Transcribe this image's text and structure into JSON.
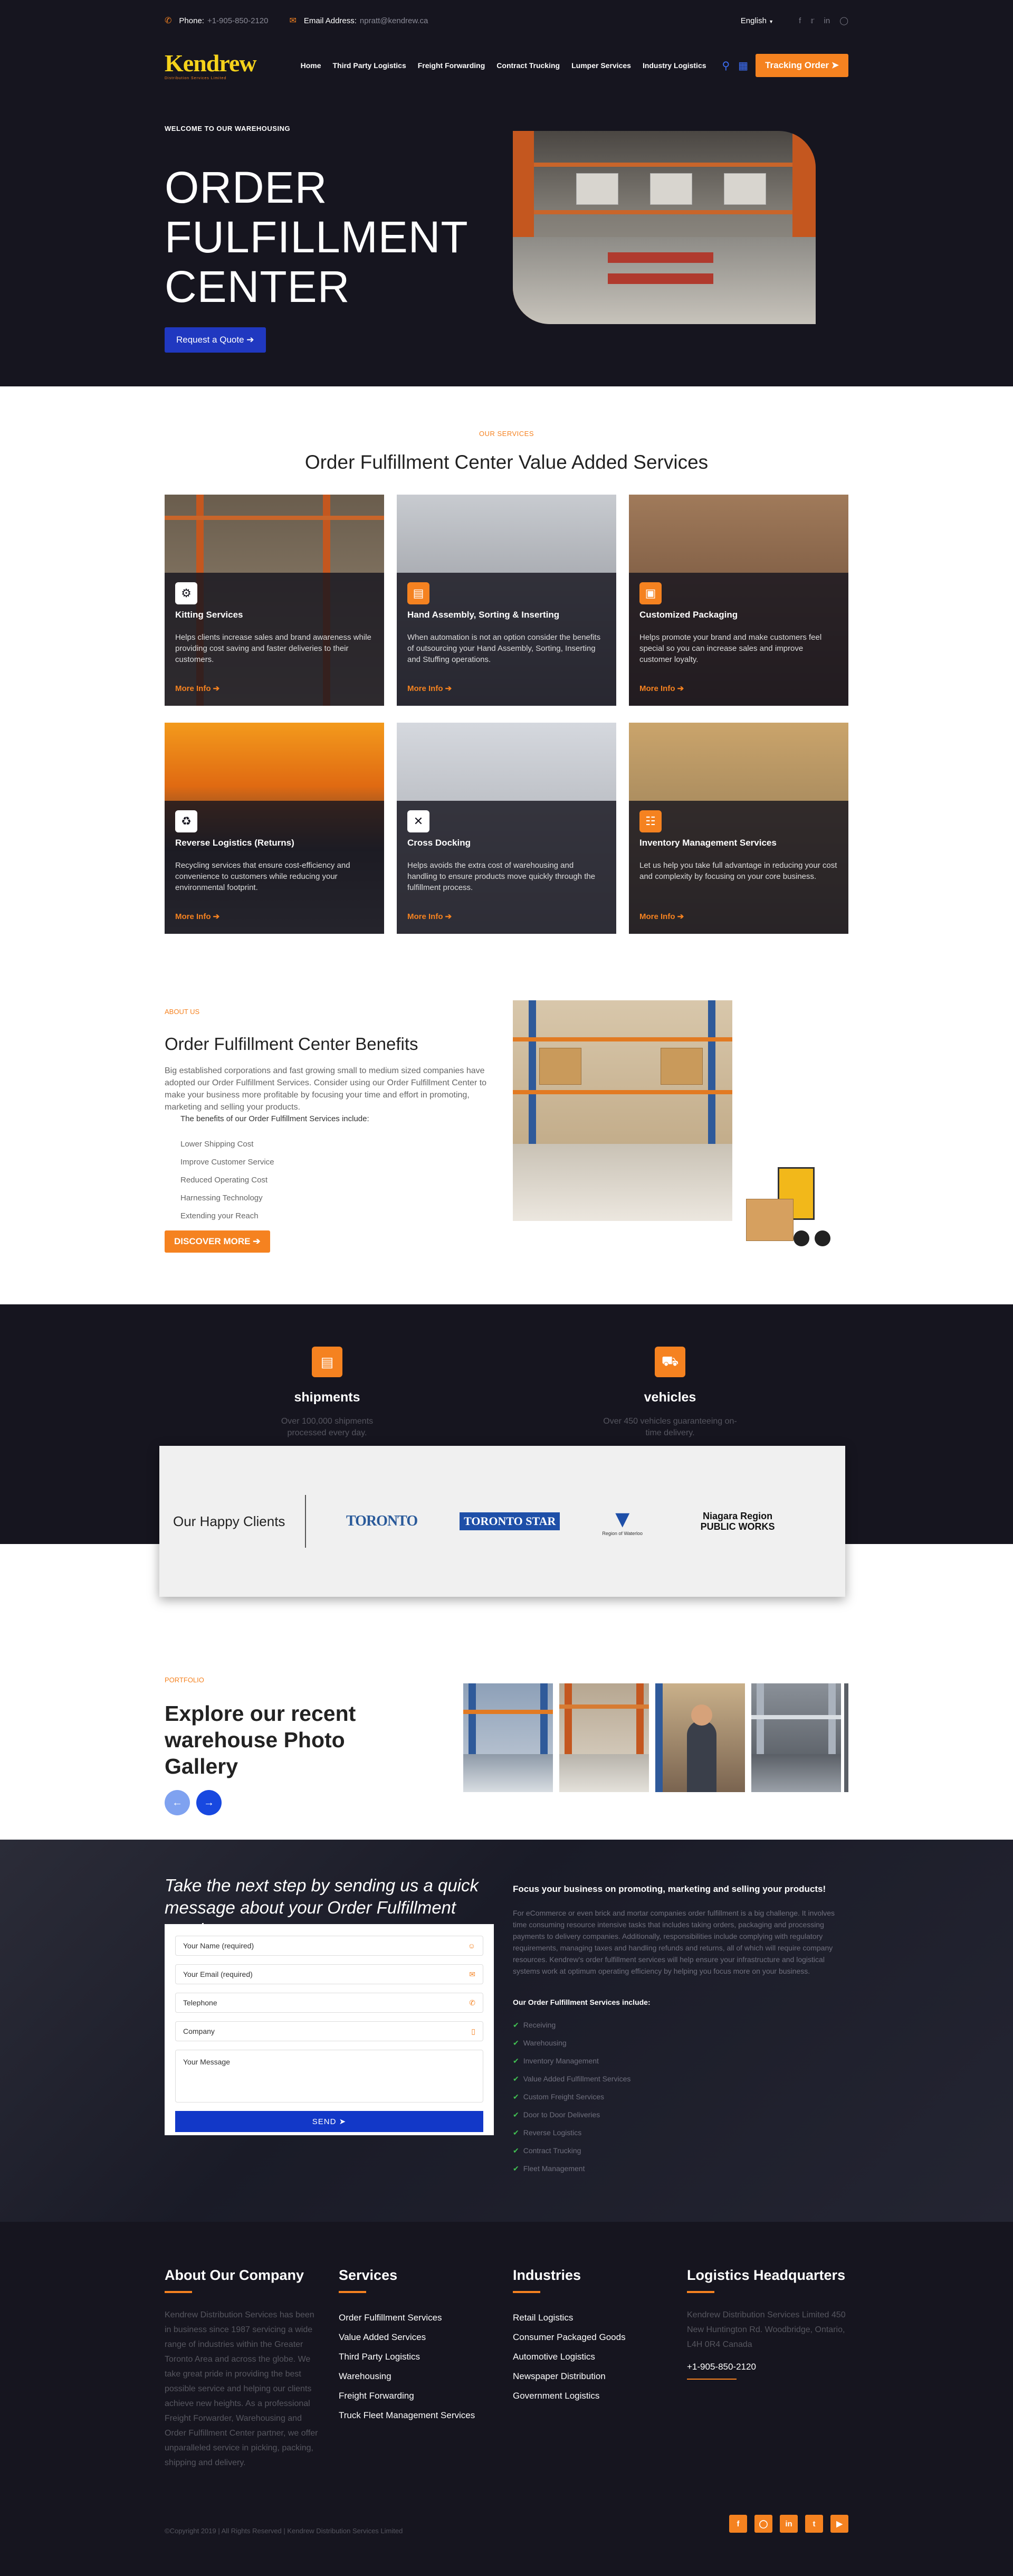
{
  "topbar": {
    "phone_label": "Phone:",
    "phone": "+1-905-850-2120",
    "email_label": "Email Address:",
    "email": "npratt@kendrew.ca",
    "language": "English",
    "social": [
      "facebook-icon",
      "twitter-icon",
      "linkedin-icon",
      "instagram-icon"
    ]
  },
  "header": {
    "logo_text": "Kendrew",
    "logo_tagline": "Distribution Services Limited",
    "nav": [
      "Home",
      "Third Party Logistics",
      "Freight Forwarding",
      "Contract Trucking",
      "Lumper Services",
      "Industry Logistics"
    ],
    "tracking_label": "Tracking Order"
  },
  "hero": {
    "eyebrow": "WELCOME TO OUR WAREHOUSING",
    "title": "ORDER FULFILLMENT CENTER",
    "cta": "Request a Quote"
  },
  "services": {
    "eyebrow": "OUR SERVICES",
    "title": "Order Fulfillment Center Value Added Services",
    "more_label": "More Info",
    "cards": [
      {
        "title": "Kitting Services",
        "text": "Helps clients increase sales and brand awareness while providing cost saving and faster deliveries to their customers.",
        "icon": "kitting-icon"
      },
      {
        "title": "Hand Assembly, Sorting & Inserting",
        "text": "When automation is not an option consider the benefits of outsourcing your Hand Assembly, Sorting, Inserting and Stuffing operations.",
        "icon": "assembly-icon"
      },
      {
        "title": "Customized Packaging",
        "text": "Helps promote your brand and make customers feel special so you can increase sales and improve customer loyalty.",
        "icon": "packaging-icon"
      },
      {
        "title": "Reverse Logistics (Returns)",
        "text": "Recycling services that ensure cost-efficiency and convenience to customers while reducing your environmental footprint.",
        "icon": "reverse-icon"
      },
      {
        "title": "Cross Docking",
        "text": "Helps avoids the extra cost of warehousing and handling to ensure products move quickly through the fulfillment process.",
        "icon": "cross-icon"
      },
      {
        "title": "Inventory Management Services",
        "text": "Let us help you take full advantage in reducing your cost and complexity by focusing on your core business.",
        "icon": "inventory-icon"
      }
    ]
  },
  "about": {
    "eyebrow": "ABOUT US",
    "title": "Order Fulfillment Center Benefits",
    "intro": "Big established corporations and fast growing small to medium sized companies have adopted our Order Fulfillment Services. Consider using our Order Fulfillment Center to make your business more profitable by focusing your time and effort in promoting, marketing and selling your products.",
    "lead": "The benefits of our Order Fulfillment Services include:",
    "benefits": [
      "Lower Shipping Cost",
      "Improve Customer Service",
      "Reduced Operating Cost",
      "Harnessing Technology",
      "Extending your Reach"
    ],
    "cta": "DISCOVER MORE"
  },
  "stats": [
    {
      "title": "shipments",
      "text": "Over 100,000 shipments processed every day."
    },
    {
      "title": "vehicles",
      "text": "Over 450 vehicles guaranteeing on-time delivery."
    }
  ],
  "clients": {
    "label": "Our Happy Clients",
    "logos": [
      "TORONTO",
      "TORONTO STAR",
      "Region of Waterloo",
      "Niagara Region PUBLIC WORKS"
    ]
  },
  "gallery": {
    "eyebrow": "PORTFOLIO",
    "title": "Explore our recent warehouse Photo Gallery"
  },
  "contact": {
    "title": "Take the next step by sending us a quick message about your Order Fulfillment requirements.",
    "fields": [
      "Your Name (required)",
      "Your Email (required)",
      "Telephone",
      "Company"
    ],
    "message": "Your Message",
    "send": "SEND",
    "right_title": "Focus your business on promoting, marketing and selling your products!",
    "right_body": "For eCommerce or even brick and mortar companies order fulfillment is a big challenge. It involves time consuming resource intensive tasks that includes taking orders, packaging and processing payments to delivery companies. Additionally, responsibilities include complying with regulatory requirements, managing taxes and handling refunds and returns, all of which will require company resources. Kendrew's order fulfillment services will help ensure your infrastructure and logistical systems work at optimum operating efficiency by helping you focus more on your business.",
    "right_lead": "Our Order Fulfillment Services include:",
    "services": [
      "Receiving",
      "Warehousing",
      "Inventory Management",
      "Value Added Fulfillment Services",
      "Custom Freight Services",
      "Door to Door Deliveries",
      "Reverse Logistics",
      "Contract Trucking",
      "Fleet Management"
    ]
  },
  "footer": {
    "about_title": "About Our Company",
    "about_text": "Kendrew Distribution Services has been in business since 1987 servicing a wide range of industries within the Greater Toronto Area and across the globe. We take great pride in providing the best possible service and helping our clients achieve new heights. As a professional Freight Forwarder, Warehousing and Order Fulfillment Center partner, we offer unparalleled service in picking, packing, shipping and delivery.",
    "services_title": "Services",
    "services": [
      "Order Fulfillment Services",
      "Value Added Services",
      "Third Party Logistics",
      "Warehousing",
      "Freight Forwarding",
      "Truck Fleet Management Services"
    ],
    "industries_title": "Industries",
    "industries": [
      "Retail Logistics",
      "Consumer Packaged Goods",
      "Automotive Logistics",
      "Newspaper Distribution",
      "Government Logistics"
    ],
    "hq_title": "Logistics Headquarters",
    "hq_address": "Kendrew Distribution Services Limited 450 New Huntington Rd. Woodbridge, Ontario, L4H 0R4 Canada",
    "hq_phone": "+1-905-850-2120",
    "copyright": "©Copyright 2019 | All Rights Reserved | Kendrew Distribution Services Limited",
    "social": [
      "facebook-icon",
      "instagram-icon",
      "linkedin-icon",
      "twitter-icon",
      "youtube-icon"
    ]
  },
  "colors": {
    "accent": "#f58220",
    "dark": "#16151f",
    "blue": "#2038c0"
  }
}
